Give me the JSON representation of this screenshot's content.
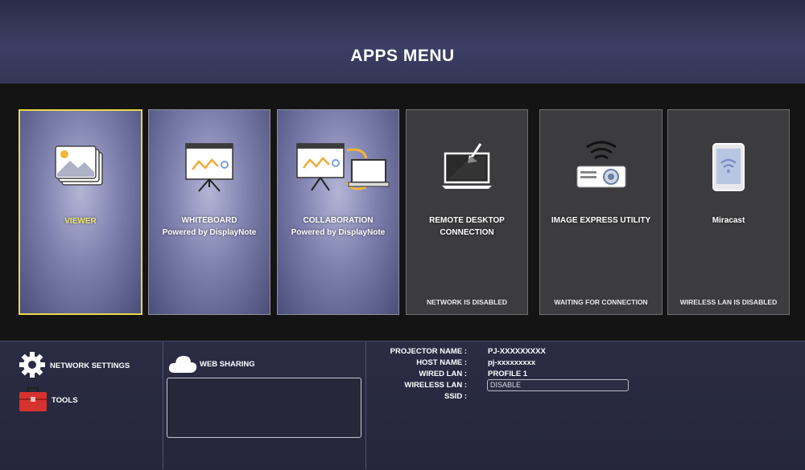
{
  "header": {
    "title": "APPS MENU"
  },
  "apps": [
    {
      "label": "VIEWER",
      "sub": "",
      "status": "",
      "icon": "viewer-photos-icon"
    },
    {
      "label": "WHITEBOARD",
      "sub": "Powered by DisplayNote",
      "status": "",
      "icon": "whiteboard-easel-icon"
    },
    {
      "label": "COLLABORATION",
      "sub": "Powered by DisplayNote",
      "status": "",
      "icon": "collaboration-icon"
    },
    {
      "label": "REMOTE DESKTOP CONNECTION",
      "sub": "",
      "status": "NETWORK IS DISABLED",
      "icon": "remote-desktop-laptop-icon"
    },
    {
      "label": "IMAGE EXPRESS UTILITY",
      "sub": "",
      "status": "WAITING FOR CONNECTION",
      "icon": "projector-wireless-icon"
    },
    {
      "label": "Miracast",
      "sub": "",
      "status": "WIRELESS LAN IS DISABLED",
      "icon": "tablet-wifi-icon"
    }
  ],
  "bottom": {
    "network_settings": "NETWORK SETTINGS",
    "tools": "TOOLS",
    "web_sharing": "WEB SHARING"
  },
  "info": {
    "projector_name_label": "PROJECTOR NAME :",
    "projector_name_value": "PJ-XXXXXXXXX",
    "host_name_label": "HOST NAME :",
    "host_name_value": "pj-xxxxxxxxx",
    "wired_lan_label": "WIRED LAN :",
    "wired_lan_value": "PROFILE 1",
    "wireless_lan_label": "WIRELESS LAN :",
    "wireless_lan_value": "DISABLE",
    "ssid_label": "SSID :"
  },
  "colors": {
    "selection_border": "#e9d94a",
    "tools_red": "#d6332e"
  }
}
